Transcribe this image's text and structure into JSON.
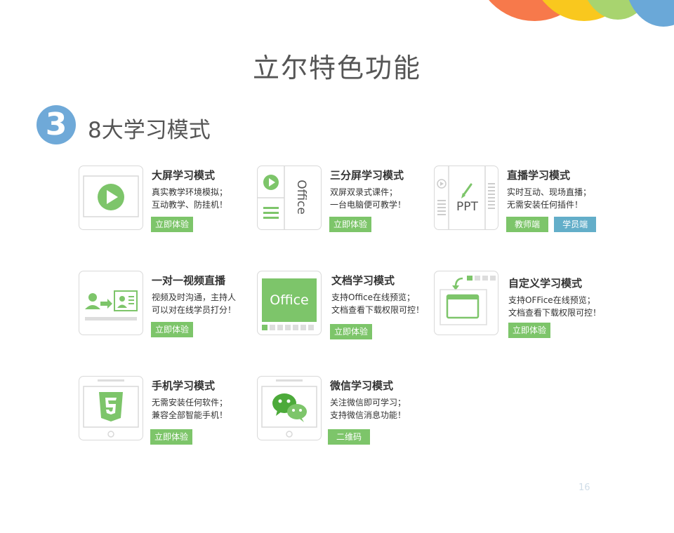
{
  "page": {
    "title": "立尔特色功能",
    "section_number": "3",
    "section_title": "8大学习模式",
    "page_number": "16"
  },
  "colors": {
    "accent_green": "#7dc56a",
    "accent_blue": "#63aec9",
    "badge_blue": "#6fa9d8",
    "bubble_orange": "#f7794b",
    "bubble_yellow": "#f9c81e",
    "bubble_green": "#a8d46f",
    "bubble_blue": "#6aa8d8"
  },
  "cards": [
    {
      "title": "大屏学习模式",
      "desc1": "真实教学环境模拟；",
      "desc2": "互动教学、防挂机！",
      "buttons": [
        "立即体验"
      ],
      "icon": "play-screen-icon"
    },
    {
      "title": "三分屏学习模式",
      "desc1": "双屏双录式课件；",
      "desc2": "一台电脑便可教学！",
      "buttons": [
        "立即体验"
      ],
      "icon": "three-split-screen-icon",
      "icon_text": "Office"
    },
    {
      "title": "直播学习模式",
      "desc1": "实时互动、现场直播；",
      "desc2": "无需安装任何插件！",
      "buttons": [
        "教师端",
        "学员端"
      ],
      "icon": "ppt-live-icon",
      "icon_text": "PPT"
    },
    {
      "title": "一对一视频直播",
      "desc1": "视频及时沟通，主持人",
      "desc2": "可以对在线学员打分！",
      "buttons": [
        "立即体验"
      ],
      "icon": "one-on-one-video-icon"
    },
    {
      "title": "文档学习模式",
      "desc1": "支持Office在线预览；",
      "desc2": "文档查看下载权限可控！",
      "buttons": [
        "立即体验"
      ],
      "icon": "office-document-icon",
      "icon_text": "Office"
    },
    {
      "title": "自定义学习模式",
      "desc1": "支持OFFice在线预览；",
      "desc2": "文档查看下载权限可控！",
      "buttons": [
        "立即体验"
      ],
      "icon": "custom-layout-icon"
    },
    {
      "title": "手机学习模式",
      "desc1": "无需安装任何软件；",
      "desc2": "兼容全部智能手机！",
      "buttons": [
        "立即体验"
      ],
      "icon": "html5-phone-icon"
    },
    {
      "title": "微信学习模式",
      "desc1": "关注微信即可学习；",
      "desc2": "支持微信消息功能！",
      "buttons": [
        "二维码"
      ],
      "icon": "wechat-icon"
    }
  ]
}
